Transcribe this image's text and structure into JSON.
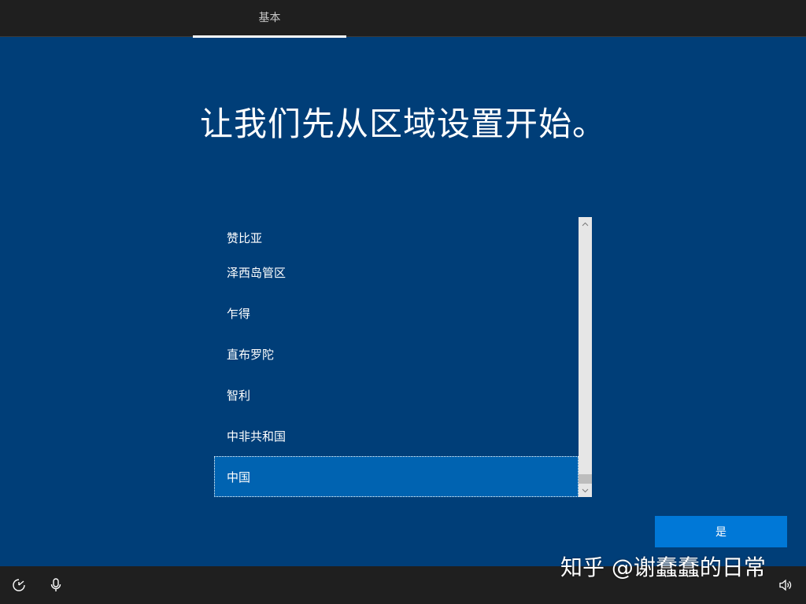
{
  "header": {
    "tab_label": "基本"
  },
  "main": {
    "title": "让我们先从区域设置开始。"
  },
  "region_list": {
    "items": [
      {
        "label": "赞比亚",
        "selected": false
      },
      {
        "label": "泽西岛管区",
        "selected": false
      },
      {
        "label": "乍得",
        "selected": false
      },
      {
        "label": "直布罗陀",
        "selected": false
      },
      {
        "label": "智利",
        "selected": false
      },
      {
        "label": "中非共和国",
        "selected": false
      },
      {
        "label": "中国",
        "selected": true
      }
    ],
    "selected_color": "#0063b1"
  },
  "actions": {
    "yes_label": "是",
    "accent_color": "#0078d7"
  },
  "footer": {
    "icons": [
      "ease-of-access-icon",
      "microphone-icon",
      "volume-icon"
    ]
  },
  "watermark": {
    "text": "知乎 @谢蠢蠢的日常"
  },
  "colors": {
    "background": "#003e78",
    "bar": "#1f1f1f"
  }
}
